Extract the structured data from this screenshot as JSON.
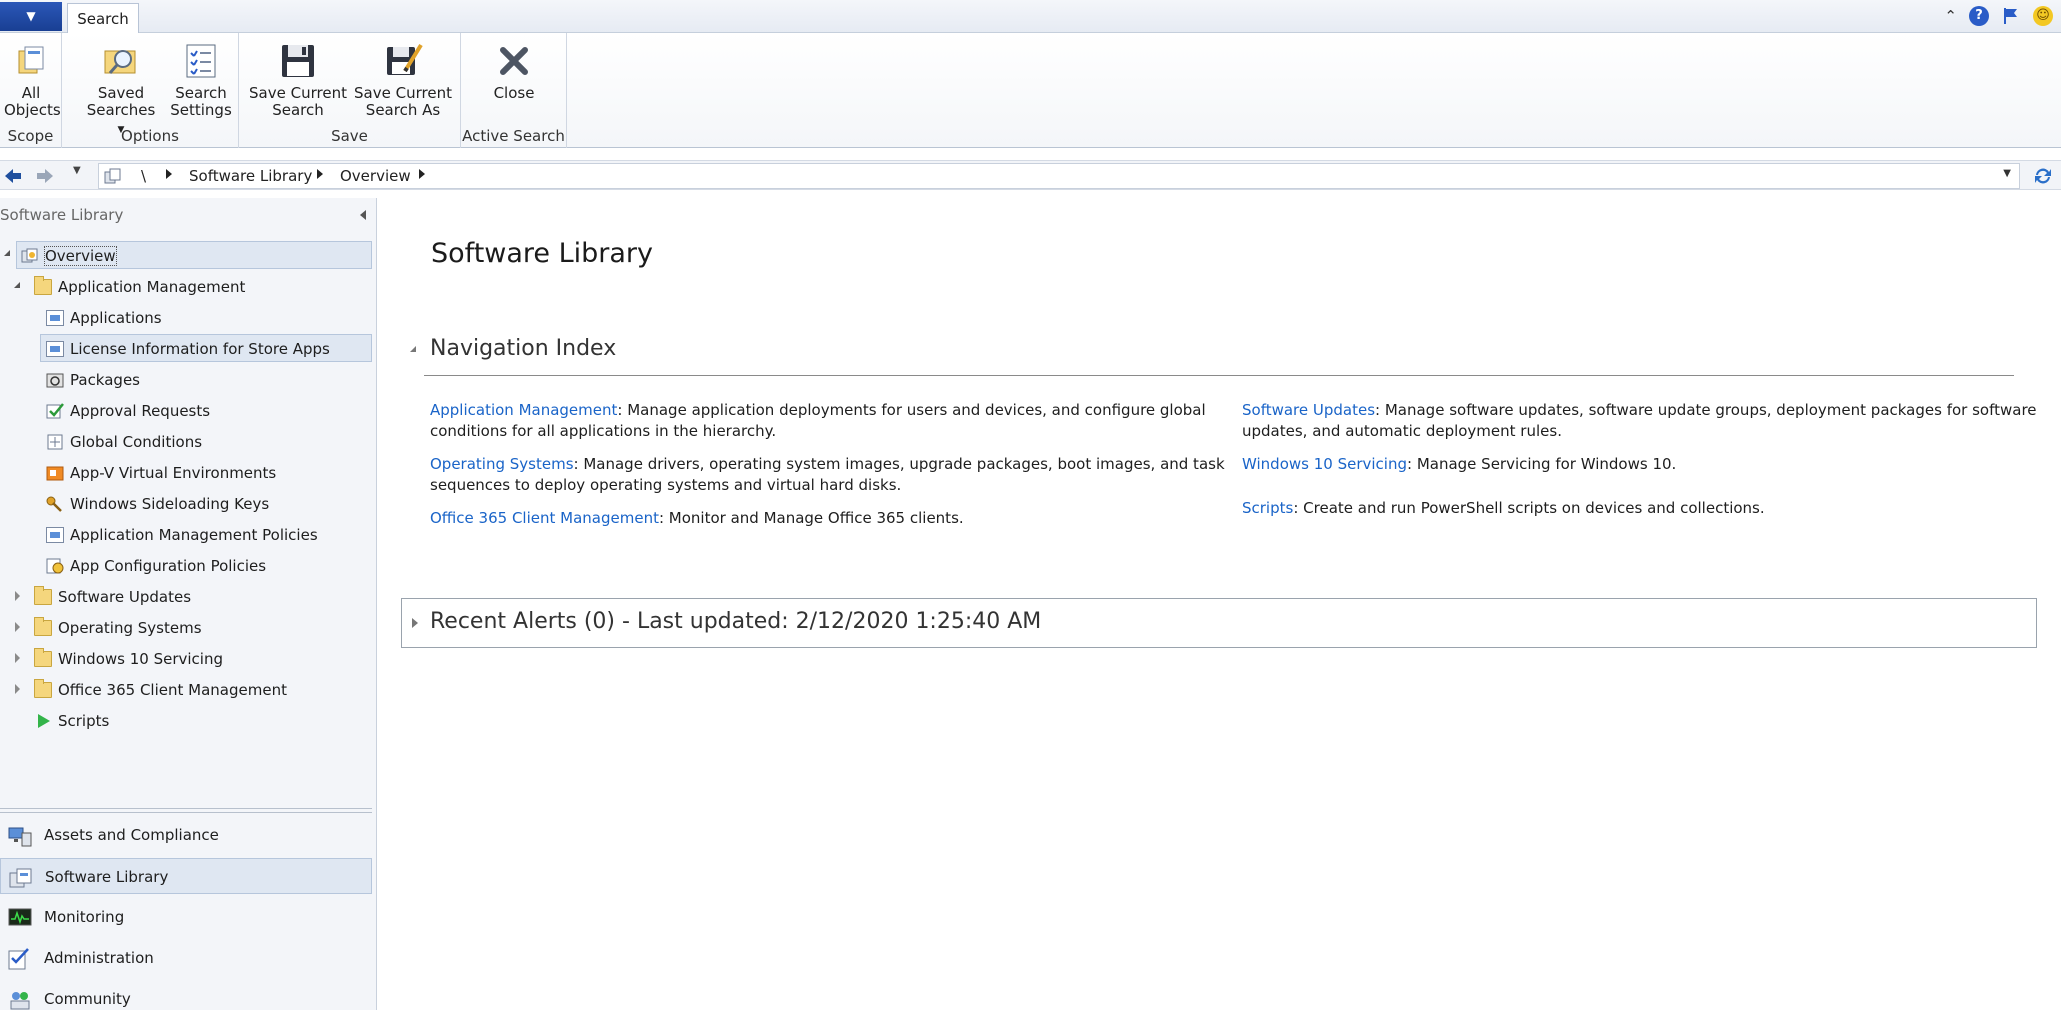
{
  "tabs": {
    "active": "Search"
  },
  "ribbon": {
    "groups": [
      {
        "label": "Scope",
        "buttons": [
          {
            "label_1": "All",
            "label_2": "Objects"
          }
        ]
      },
      {
        "label": "Options",
        "buttons": [
          {
            "label_1": "Saved",
            "label_2": "Searches"
          },
          {
            "label_1": "Search",
            "label_2": "Settings"
          }
        ]
      },
      {
        "label": "Save",
        "buttons": [
          {
            "label_1": "Save Current",
            "label_2": "Search"
          },
          {
            "label_1": "Save Current",
            "label_2": "Search As"
          }
        ]
      },
      {
        "label": "Active Search",
        "buttons": [
          {
            "label_1": "Close",
            "label_2": ""
          }
        ]
      }
    ]
  },
  "address": {
    "root": "\\",
    "crumbs": [
      "Software Library",
      "Overview"
    ]
  },
  "nav": {
    "pane_title": "Software Library",
    "tree": [
      {
        "label": "Overview"
      },
      {
        "label": "Application Management"
      },
      {
        "label": "Applications"
      },
      {
        "label": "License Information for Store Apps"
      },
      {
        "label": "Packages"
      },
      {
        "label": "Approval Requests"
      },
      {
        "label": "Global Conditions"
      },
      {
        "label": "App-V Virtual Environments"
      },
      {
        "label": "Windows Sideloading Keys"
      },
      {
        "label": "Application Management Policies"
      },
      {
        "label": "App Configuration Policies"
      },
      {
        "label": "Software Updates"
      },
      {
        "label": "Operating Systems"
      },
      {
        "label": "Windows 10 Servicing"
      },
      {
        "label": "Office 365 Client Management"
      },
      {
        "label": "Scripts"
      }
    ],
    "workspaces": [
      {
        "label": "Assets and Compliance"
      },
      {
        "label": "Software Library"
      },
      {
        "label": "Monitoring"
      },
      {
        "label": "Administration"
      },
      {
        "label": "Community"
      }
    ]
  },
  "main": {
    "title": "Software Library",
    "nav_index_title": "Navigation Index",
    "entries_left": [
      {
        "link": "Application Management",
        "text_1": ": Manage application deployments for users and devices, and configure global",
        "text_2": "conditions for all applications in the hierarchy."
      },
      {
        "link": "Operating Systems",
        "text_1": ": Manage drivers, operating system images, upgrade packages, boot images, and task",
        "text_2": "sequences to deploy operating systems and virtual hard disks."
      },
      {
        "link": "Office 365 Client Management",
        "text_1": ": Monitor and Manage Office 365 clients.",
        "text_2": ""
      }
    ],
    "entries_right": [
      {
        "link": "Software Updates",
        "text_1": ": Manage software updates, software update groups, deployment packages for software",
        "text_2": "updates, and automatic deployment rules."
      },
      {
        "link": "Windows 10 Servicing",
        "text_1": ": Manage Servicing for Windows 10.",
        "text_2": ""
      },
      {
        "link": "Scripts",
        "text_1": ": Create and run PowerShell scripts on devices and collections.",
        "text_2": ""
      }
    ],
    "alerts_title": "Recent Alerts (0) - Last updated: 2/12/2020 1:25:40 AM"
  },
  "colors": {
    "link": "#1a64c8",
    "accent": "#2b57b8",
    "selection": "#dfe7f2"
  }
}
